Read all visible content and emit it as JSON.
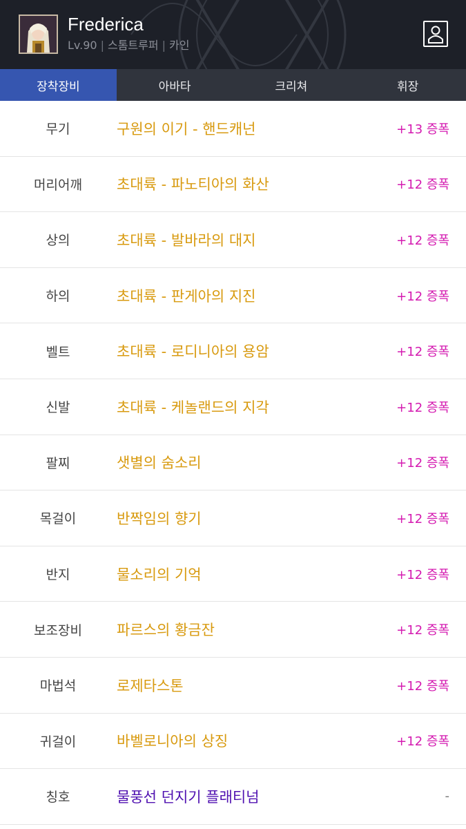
{
  "header": {
    "character_name": "Frederica",
    "level": "Lv.90",
    "job": "스톰트루퍼",
    "server": "카인",
    "separator": "|"
  },
  "tabs": [
    {
      "label": "장착장비",
      "active": true
    },
    {
      "label": "아바타",
      "active": false
    },
    {
      "label": "크리쳐",
      "active": false
    },
    {
      "label": "휘장",
      "active": false
    }
  ],
  "equipment": [
    {
      "slot": "무기",
      "name": "구원의 이기 - 핸드캐넌",
      "amp": "+13 증폭"
    },
    {
      "slot": "머리어깨",
      "name": "초대륙 - 파노티아의 화산",
      "amp": "+12 증폭"
    },
    {
      "slot": "상의",
      "name": "초대륙 - 발바라의 대지",
      "amp": "+12 증폭"
    },
    {
      "slot": "하의",
      "name": "초대륙 - 판게아의 지진",
      "amp": "+12 증폭"
    },
    {
      "slot": "벨트",
      "name": "초대륙 - 로디니아의 용암",
      "amp": "+12 증폭"
    },
    {
      "slot": "신발",
      "name": "초대륙 - 케놀랜드의 지각",
      "amp": "+12 증폭"
    },
    {
      "slot": "팔찌",
      "name": "샛별의 숨소리",
      "amp": "+12 증폭"
    },
    {
      "slot": "목걸이",
      "name": "반짝임의 향기",
      "amp": "+12 증폭"
    },
    {
      "slot": "반지",
      "name": "물소리의 기억",
      "amp": "+12 증폭"
    },
    {
      "slot": "보조장비",
      "name": "파르스의 황금잔",
      "amp": "+12 증폭"
    },
    {
      "slot": "마법석",
      "name": "로제타스톤",
      "amp": "+12 증폭"
    },
    {
      "slot": "귀걸이",
      "name": "바벨로니아의 상징",
      "amp": "+12 증폭"
    },
    {
      "slot": "칭호",
      "name": "물풍선 던지기 플래티넘",
      "amp": "-"
    }
  ],
  "colors": {
    "header_bg": "#1d2028",
    "tab_bar_bg": "#30343d",
    "tab_active_bg": "#3656b0",
    "item_epic": "#d89a0f",
    "item_title": "#4e0fb0",
    "amp_text": "#d41ab0"
  },
  "icons": {
    "avatar": "character-portrait",
    "profile": "profile-card-icon",
    "background": "emblem-pattern"
  }
}
